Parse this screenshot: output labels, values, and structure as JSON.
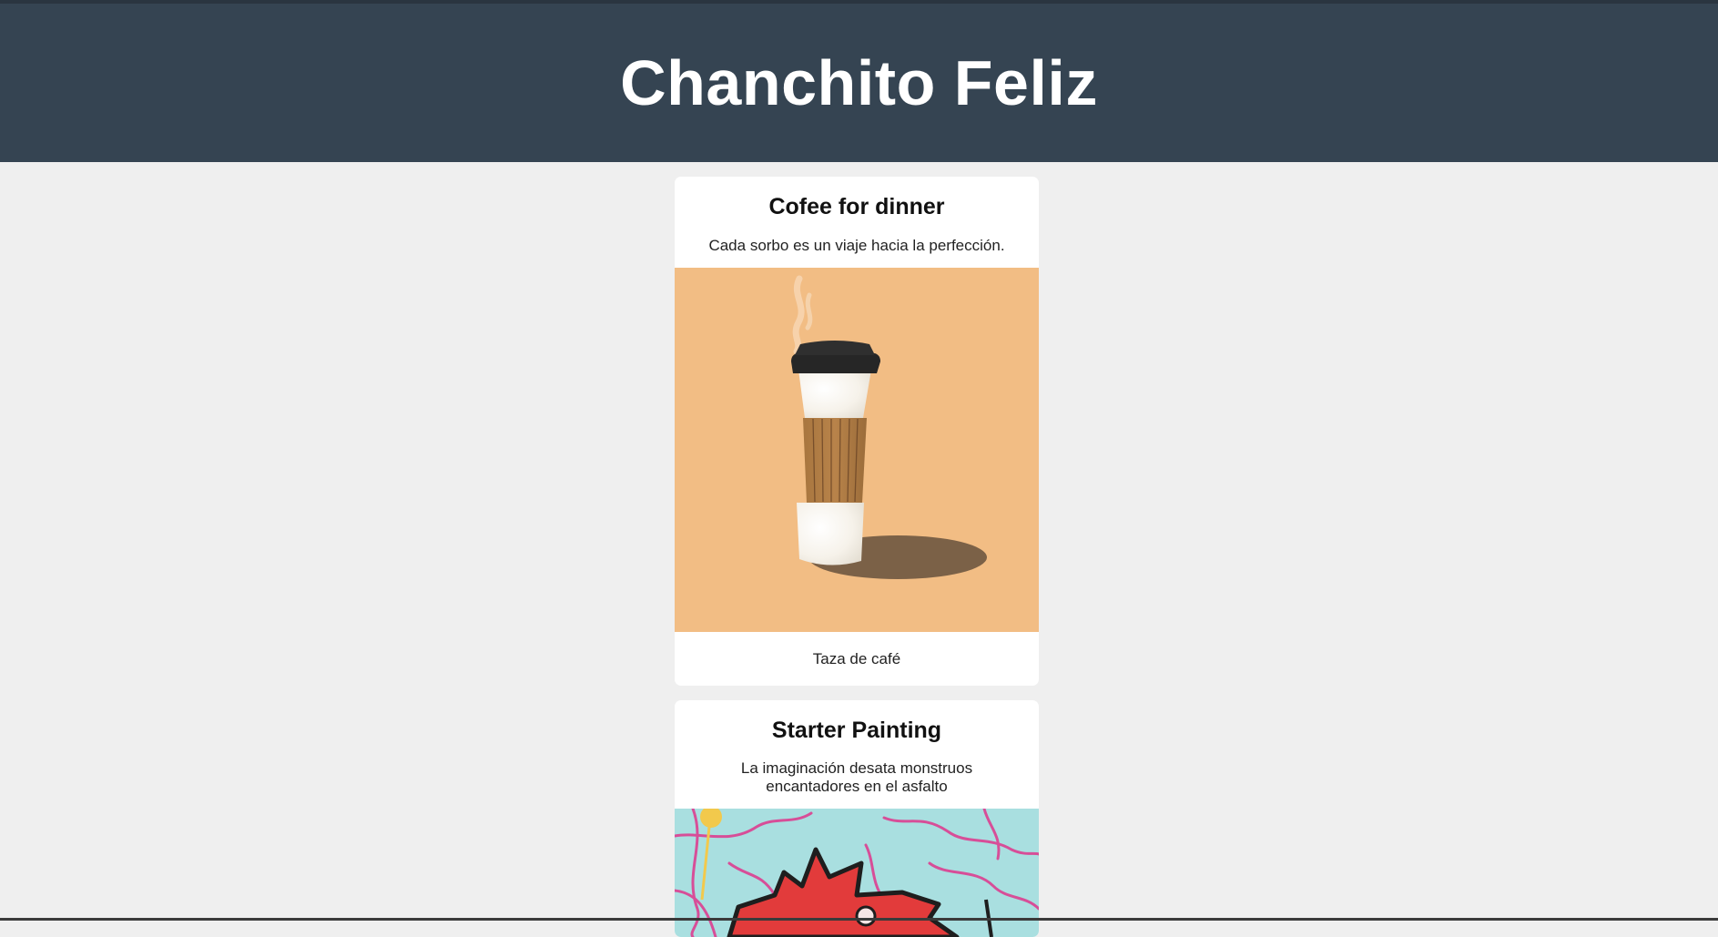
{
  "header": {
    "title": "Chanchito Feliz"
  },
  "cards": [
    {
      "title": "Cofee for dinner",
      "description": "Cada sorbo es un viaje hacia la perfección.",
      "caption": "Taza de café",
      "image_icon": "coffee-cup-illustration"
    },
    {
      "title": "Starter Painting",
      "description": "La imaginación desata monstruos encantadores en el asfalto",
      "image_icon": "monster-painting-illustration"
    }
  ],
  "colors": {
    "header_bg": "#354452",
    "page_bg": "#efefef",
    "card_bg": "#ffffff",
    "coffee_bg": "#f2bd84"
  }
}
